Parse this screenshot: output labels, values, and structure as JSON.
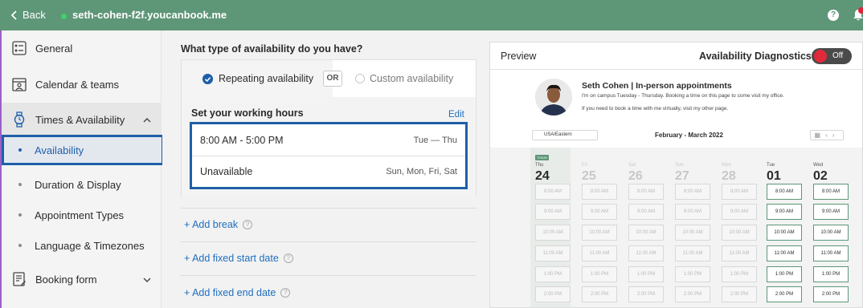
{
  "topbar": {
    "back_label": "Back",
    "url": "seth-cohen-f2f.youcanbook.me",
    "help_label": "?"
  },
  "sidebar": {
    "items": [
      {
        "label": "General"
      },
      {
        "label": "Calendar & teams"
      },
      {
        "label": "Times & Availability"
      },
      {
        "label": "Booking form"
      }
    ],
    "subitems": [
      {
        "label": "Availability"
      },
      {
        "label": "Duration & Display"
      },
      {
        "label": "Appointment Types"
      },
      {
        "label": "Language & Timezones"
      }
    ]
  },
  "main": {
    "question": "What type of availability do you have?",
    "option_repeating": "Repeating availability",
    "or_label": "OR",
    "option_custom": "Custom availability",
    "working_hours_title": "Set your working hours",
    "edit_label": "Edit",
    "hours": [
      {
        "time": "8:00 AM - 5:00 PM",
        "days": "Tue — Thu"
      },
      {
        "time": "Unavailable",
        "days": "Sun, Mon, Fri, Sat"
      }
    ],
    "add_break": "+ Add break",
    "add_start": "+ Add fixed start date",
    "add_end": "+ Add fixed end date",
    "help_glyph": "?"
  },
  "preview": {
    "title": "Preview",
    "diagnostics": "Availability Diagnostics",
    "toggle_label": "Off",
    "name": "Seth Cohen | In-person appointments",
    "desc1": "I'm on campus Tuesday - Thursday. Booking a time on this page to come visit my office.",
    "desc2": "If you need to book a time with me virtually, visit my other page.",
    "timezone": "USA/Eastern",
    "month": "February - March 2022",
    "today_tag": "TODAY",
    "days": [
      {
        "name": "Thu",
        "num": "24",
        "today": true,
        "available": false
      },
      {
        "name": "Fri",
        "num": "25",
        "today": false,
        "available": false
      },
      {
        "name": "Sat",
        "num": "26",
        "today": false,
        "available": false
      },
      {
        "name": "Sun",
        "num": "27",
        "today": false,
        "available": false
      },
      {
        "name": "Mon",
        "num": "28",
        "today": false,
        "available": false
      },
      {
        "name": "Tue",
        "num": "01",
        "today": false,
        "available": true
      },
      {
        "name": "Wed",
        "num": "02",
        "today": false,
        "available": true
      }
    ],
    "slots": [
      "8:00 AM",
      "9:00 AM",
      "10:00 AM",
      "11:00 AM",
      "1:00 PM",
      "2:00 PM"
    ]
  },
  "colors": {
    "topbar": "#5e9678",
    "accent_blue": "#1f5fa8",
    "link_blue": "#1f6fbf",
    "toggle_red": "#e02a3a"
  }
}
